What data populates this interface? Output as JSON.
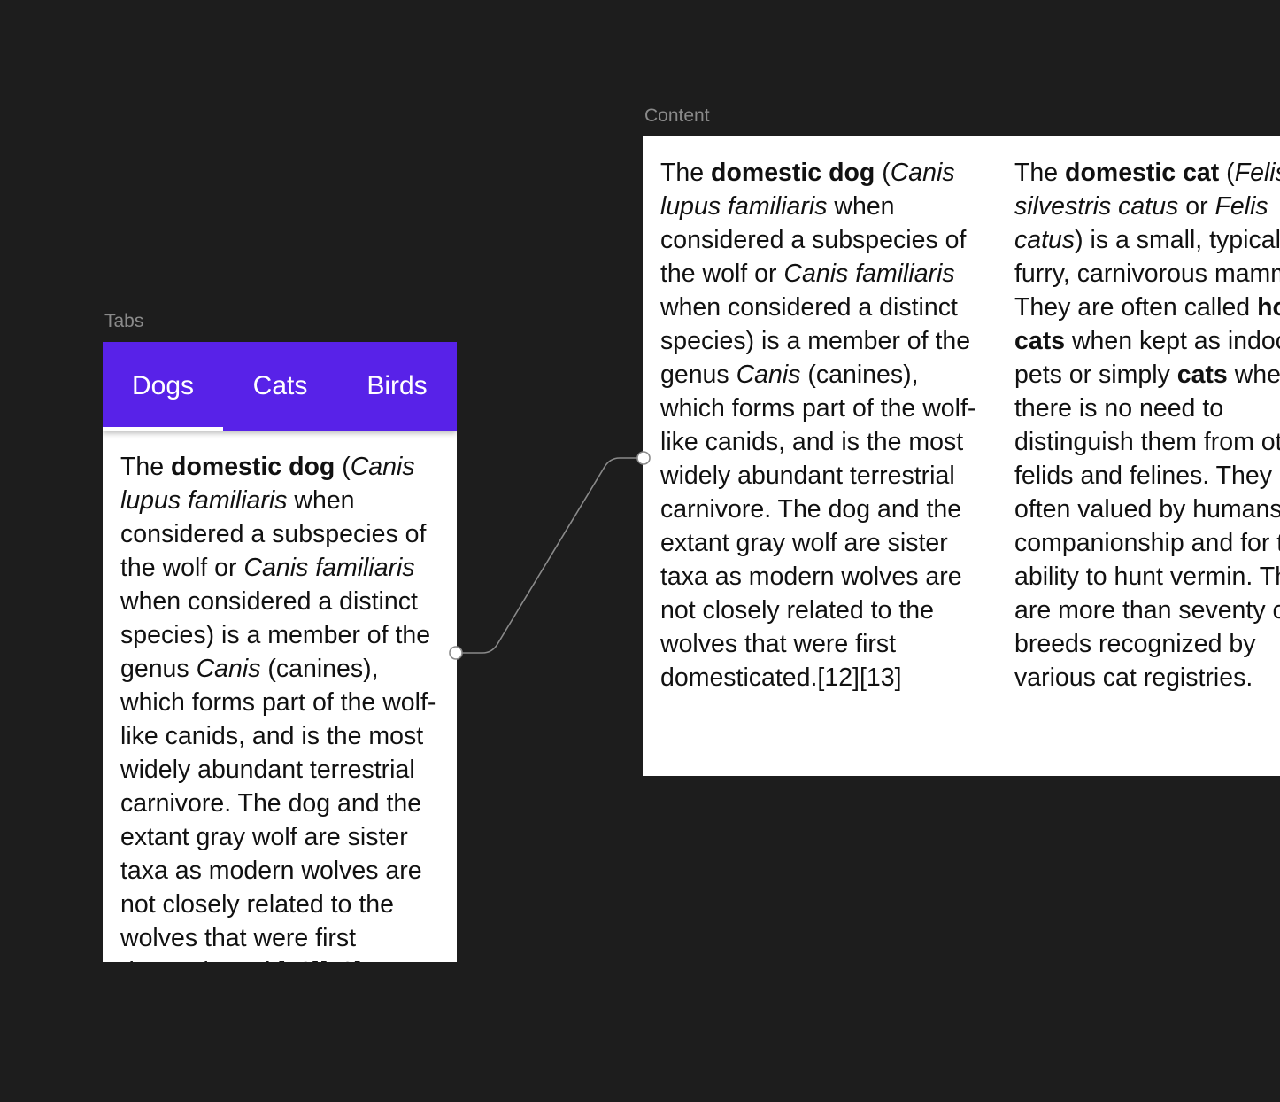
{
  "frames": {
    "tabs_label": "Tabs",
    "content_label": "Content"
  },
  "tabs": {
    "items": [
      {
        "label": "Dogs",
        "selected": true
      },
      {
        "label": "Cats",
        "selected": false
      },
      {
        "label": "Birds",
        "selected": false
      }
    ]
  },
  "dog": {
    "p1": "The ",
    "b1": "domestic dog",
    "p2": " (",
    "i1": "Canis lupus familiaris",
    "p3": " when considered a subspecies of the wolf or ",
    "i2": "Canis familiaris",
    "p4": " when considered a distinct species) is a member of the genus ",
    "i3": "Canis",
    "p5": " (canines), which forms part of the wolf-like canids, and is the most widely abundant terrestrial carnivore. The dog and the extant gray wolf are sister taxa as modern wolves are not closely related to the wolves that were first domesticated.[12][13]"
  },
  "cat": {
    "p1": "The ",
    "b1": "domestic cat",
    "p2": " (",
    "i1": "Felis silvestris catus",
    "p3": " or ",
    "i2": "Felis catus",
    "p4": ") is a small, typically furry, carnivorous mammal. They are often called ",
    "b2": "house cats",
    "p5": " when kept as indoor pets or simply ",
    "b3": "cats",
    "p6": " when there is no need to distinguish them from other felids and felines. They are often valued by humans for companionship and for their ability to hunt vermin. There are more than seventy cat breeds recognized by various cat registries."
  },
  "colors": {
    "background": "#1d1d1d",
    "tab_bar": "#5822e8",
    "label": "#8a8a8a",
    "connector": "#8a8a8a"
  }
}
